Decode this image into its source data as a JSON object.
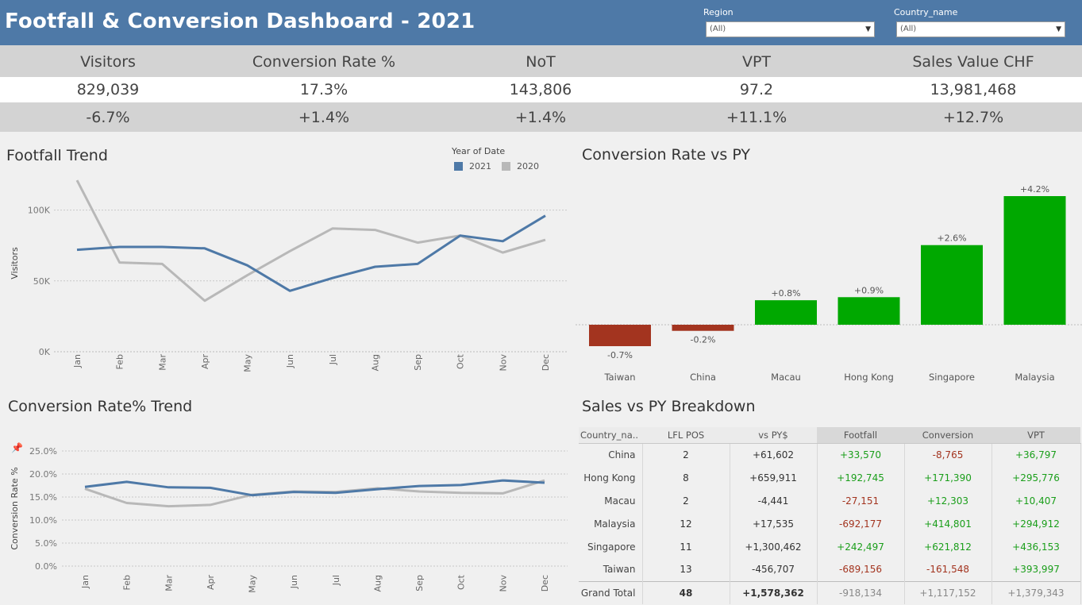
{
  "header": {
    "title": "Footfall & Conversion Dashboard - 2021",
    "filters": [
      {
        "label": "Region",
        "value": "(All)"
      },
      {
        "label": "Country_name",
        "value": "(All)"
      }
    ]
  },
  "kpis": [
    {
      "label": "Visitors",
      "value": "829,039",
      "change": "-6.7%"
    },
    {
      "label": "Conversion Rate %",
      "value": "17.3%",
      "change": "+1.4%"
    },
    {
      "label": "NoT",
      "value": "143,806",
      "change": "+1.4%"
    },
    {
      "label": "VPT",
      "value": "97.2",
      "change": "+11.1%"
    },
    {
      "label": "Sales Value CHF",
      "value": "13,981,468",
      "change": "+12.7%"
    }
  ],
  "footfall": {
    "title": "Footfall Trend",
    "legend_title": "Year of Date"
  },
  "conversion_vs_py": {
    "title": "Conversion Rate vs PY"
  },
  "conversion_trend": {
    "title": "Conversion Rate% Trend"
  },
  "sales_breakdown": {
    "title": "Sales vs PY Breakdown",
    "columns": [
      "Country_na..",
      "LFL POS",
      "vs PY$",
      "Footfall",
      "Conversion",
      "VPT"
    ],
    "rows": [
      {
        "country": "China",
        "lfl": "2",
        "vs_py": "+61,602",
        "footfall": "+33,570",
        "conversion": "-8,765",
        "vpt": "+36,797"
      },
      {
        "country": "Hong Kong",
        "lfl": "8",
        "vs_py": "+659,911",
        "footfall": "+192,745",
        "conversion": "+171,390",
        "vpt": "+295,776"
      },
      {
        "country": "Macau",
        "lfl": "2",
        "vs_py": "-4,441",
        "footfall": "-27,151",
        "conversion": "+12,303",
        "vpt": "+10,407"
      },
      {
        "country": "Malaysia",
        "lfl": "12",
        "vs_py": "+17,535",
        "footfall": "-692,177",
        "conversion": "+414,801",
        "vpt": "+294,912"
      },
      {
        "country": "Singapore",
        "lfl": "11",
        "vs_py": "+1,300,462",
        "footfall": "+242,497",
        "conversion": "+621,812",
        "vpt": "+436,153"
      },
      {
        "country": "Taiwan",
        "lfl": "13",
        "vs_py": "-456,707",
        "footfall": "-689,156",
        "conversion": "-161,548",
        "vpt": "+393,997"
      }
    ],
    "total": {
      "country": "Grand Total",
      "lfl": "48",
      "vs_py": "+1,578,362",
      "footfall": "-918,134",
      "conversion": "+1,117,152",
      "vpt": "+1,379,343"
    }
  },
  "colors": {
    "header": "#4e79a7",
    "series_2021": "#4e79a7",
    "series_2020": "#b8b8b8",
    "positive": "#00a800",
    "negative": "#a3341f"
  },
  "chart_data": [
    {
      "type": "line",
      "x": [
        "Jan",
        "Feb",
        "Mar",
        "Apr",
        "May",
        "Jun",
        "Jul",
        "Aug",
        "Sep",
        "Oct",
        "Nov",
        "Dec"
      ],
      "series": [
        {
          "name": "2021",
          "values": [
            72000,
            74000,
            74000,
            73000,
            61000,
            43000,
            52000,
            60000,
            62000,
            82000,
            78000,
            96000
          ]
        },
        {
          "name": "2020",
          "values": [
            121000,
            63000,
            62000,
            36000,
            54000,
            71000,
            87000,
            86000,
            77000,
            82000,
            70000,
            79000
          ]
        }
      ],
      "ylabel": "Visitors",
      "yticks": [
        "0K",
        "50K",
        "100K"
      ],
      "ylim": [
        0,
        125000
      ],
      "grid": true,
      "legend": "top-right"
    },
    {
      "type": "bar",
      "categories": [
        "Taiwan",
        "China",
        "Macau",
        "Hong Kong",
        "Singapore",
        "Malaysia"
      ],
      "values": [
        -0.7,
        -0.2,
        0.8,
        0.9,
        2.6,
        4.2
      ],
      "labels": [
        "-0.7%",
        "-0.2%",
        "+0.8%",
        "+0.9%",
        "+2.6%",
        "+4.2%"
      ],
      "ylim": [
        -0.9,
        4.4
      ]
    },
    {
      "type": "line",
      "x": [
        "Jan",
        "Feb",
        "Mar",
        "Apr",
        "May",
        "Jun",
        "Jul",
        "Aug",
        "Sep",
        "Oct",
        "Nov",
        "Dec"
      ],
      "series": [
        {
          "name": "2021",
          "values": [
            17.2,
            18.3,
            17.1,
            17.0,
            15.4,
            16.1,
            15.9,
            16.7,
            17.4,
            17.6,
            18.6,
            18.1
          ]
        },
        {
          "name": "2020",
          "values": [
            16.8,
            13.7,
            13.0,
            13.3,
            15.5,
            16.2,
            16.1,
            16.9,
            16.2,
            15.9,
            15.8,
            18.6
          ]
        }
      ],
      "ylabel": "Conversion Rate %",
      "yticks": [
        "0.0%",
        "5.0%",
        "10.0%",
        "15.0%",
        "20.0%",
        "25.0%"
      ],
      "ylim": [
        0,
        25
      ],
      "grid": true
    }
  ]
}
